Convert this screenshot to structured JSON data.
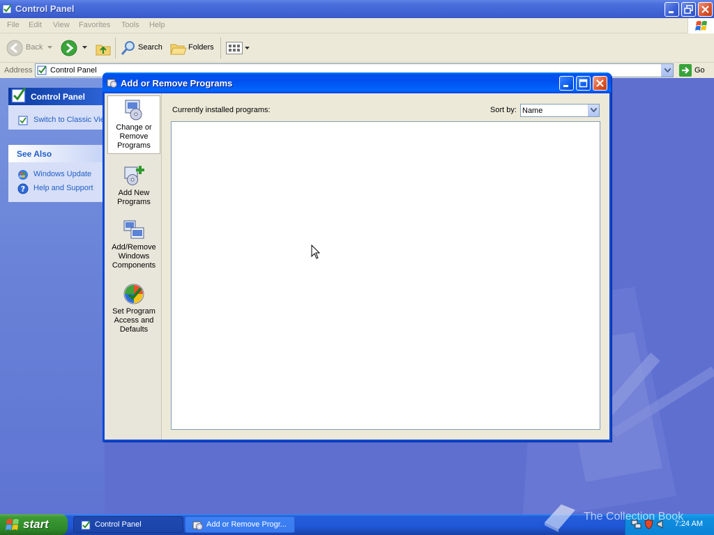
{
  "control_panel": {
    "title": "Control Panel",
    "menu": [
      "File",
      "Edit",
      "View",
      "Favorites",
      "Tools",
      "Help"
    ],
    "toolbar": {
      "back": "Back",
      "search": "Search",
      "folders": "Folders"
    },
    "address_label": "Address",
    "address_value": "Control Panel",
    "go_label": "Go",
    "task_pane": {
      "panel_title": "Control Panel",
      "switch_link": "Switch to Classic View",
      "see_also_title": "See Also",
      "links": [
        "Windows Update",
        "Help and Support"
      ]
    }
  },
  "dialog": {
    "title": "Add or Remove Programs",
    "sidebar": [
      {
        "label": "Change or Remove Programs",
        "icon": "change-remove-icon"
      },
      {
        "label": "Add New Programs",
        "icon": "add-new-icon"
      },
      {
        "label": "Add/Remove Windows Components",
        "icon": "windows-components-icon"
      },
      {
        "label": "Set Program Access and Defaults",
        "icon": "program-access-icon"
      }
    ],
    "installed_label": "Currently installed programs:",
    "sort_label": "Sort by:",
    "sort_value": "Name",
    "programs": []
  },
  "taskbar": {
    "start": "start",
    "tasks": [
      "Control Panel",
      "Add or Remove Progr..."
    ],
    "clock": "7:24 AM"
  },
  "watermark": "The Collection Book",
  "colors": {
    "xp_blue": "#0050ee",
    "taskbar_blue": "#245edb",
    "start_green": "#3c9a33",
    "link_blue": "#215dc6",
    "dialog_face": "#ece9d8"
  }
}
